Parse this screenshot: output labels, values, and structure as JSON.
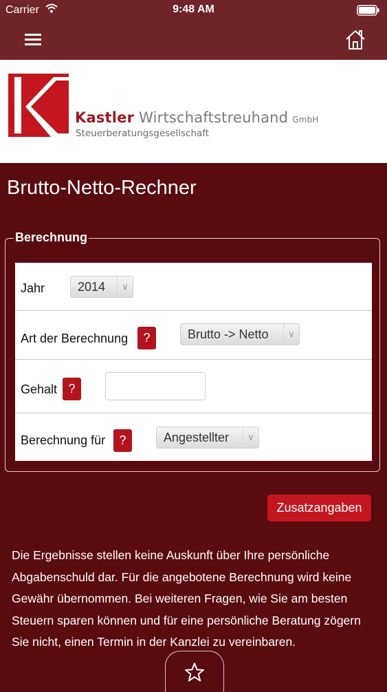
{
  "status_bar": {
    "carrier": "Carrier",
    "time": "9:48 AM"
  },
  "nav": {
    "menu_icon": "hamburger-menu-icon",
    "home_icon": "home-icon",
    "bar_color": "#6e2428"
  },
  "logo": {
    "name_bold": "Kastler",
    "name_rest": "Wirtschaftstreuhand",
    "suffix": "GmbH",
    "subtitle": "Steuerberatungsgesellschaft",
    "brand_color": "#c4161f"
  },
  "page": {
    "title": "Brutto-Netto-Rechner",
    "background": "#5a0b10"
  },
  "form": {
    "legend": "Berechnung",
    "help_label": "?",
    "rows": {
      "jahr": {
        "label": "Jahr",
        "value": "2014"
      },
      "art": {
        "label": "Art der Berechnung",
        "value": "Brutto -> Netto"
      },
      "gehalt": {
        "label": "Gehalt",
        "value": ""
      },
      "fuer": {
        "label": "Berechnung für",
        "value": "Angestellter"
      }
    }
  },
  "buttons": {
    "zusatz": "Zusatzangaben"
  },
  "disclaimer": "Die Ergebnisse stellen keine Auskunft über Ihre persönliche Abgabenschuld dar. Für die angebotene Berechnung wird keine Gewähr übernommen. Bei weiteren Fragen, wie Sie am besten Steuern sparen können und für eine persönliche Beratung zögern Sie nicht, einen Termin in der Kanzlei zu vereinbaren.",
  "favorite": {
    "icon": "star-icon"
  }
}
